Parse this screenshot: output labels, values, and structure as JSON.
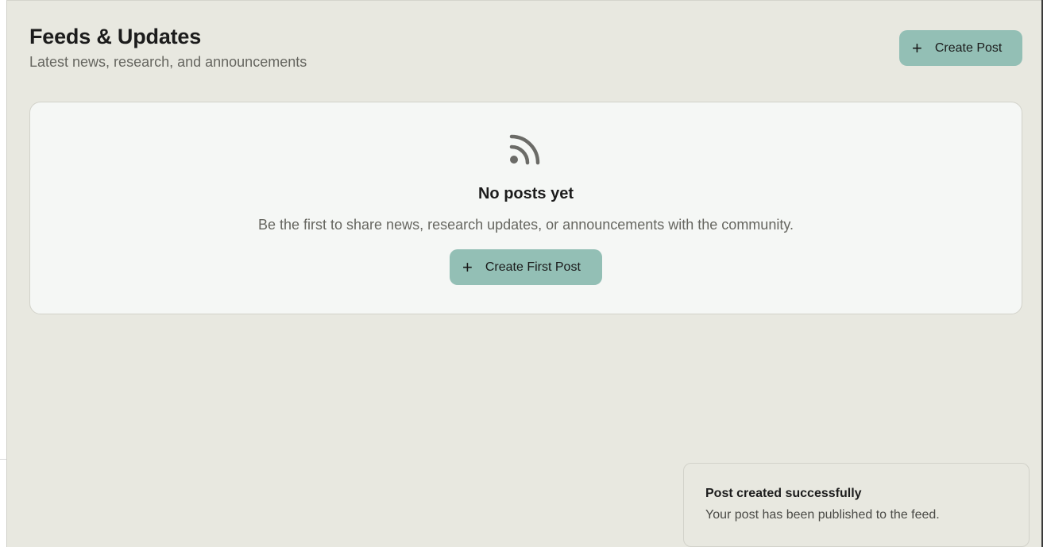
{
  "header": {
    "title": "Feeds & Updates",
    "subtitle": "Latest news, research, and announcements",
    "create_button_label": "Create Post",
    "create_button_icon": "plus-icon"
  },
  "empty_state": {
    "icon": "rss-icon",
    "title": "No posts yet",
    "description": "Be the first to share news, research updates, or announcements with the community.",
    "button_label": "Create First Post",
    "button_icon": "plus-icon"
  },
  "toast": {
    "title": "Post created successfully",
    "message": "Your post has been published to the feed."
  },
  "colors": {
    "background": "#e8e8e0",
    "card": "#f5f7f5",
    "accent": "#93bfb5",
    "text": "#1c1c1c",
    "muted_text": "#666660"
  }
}
